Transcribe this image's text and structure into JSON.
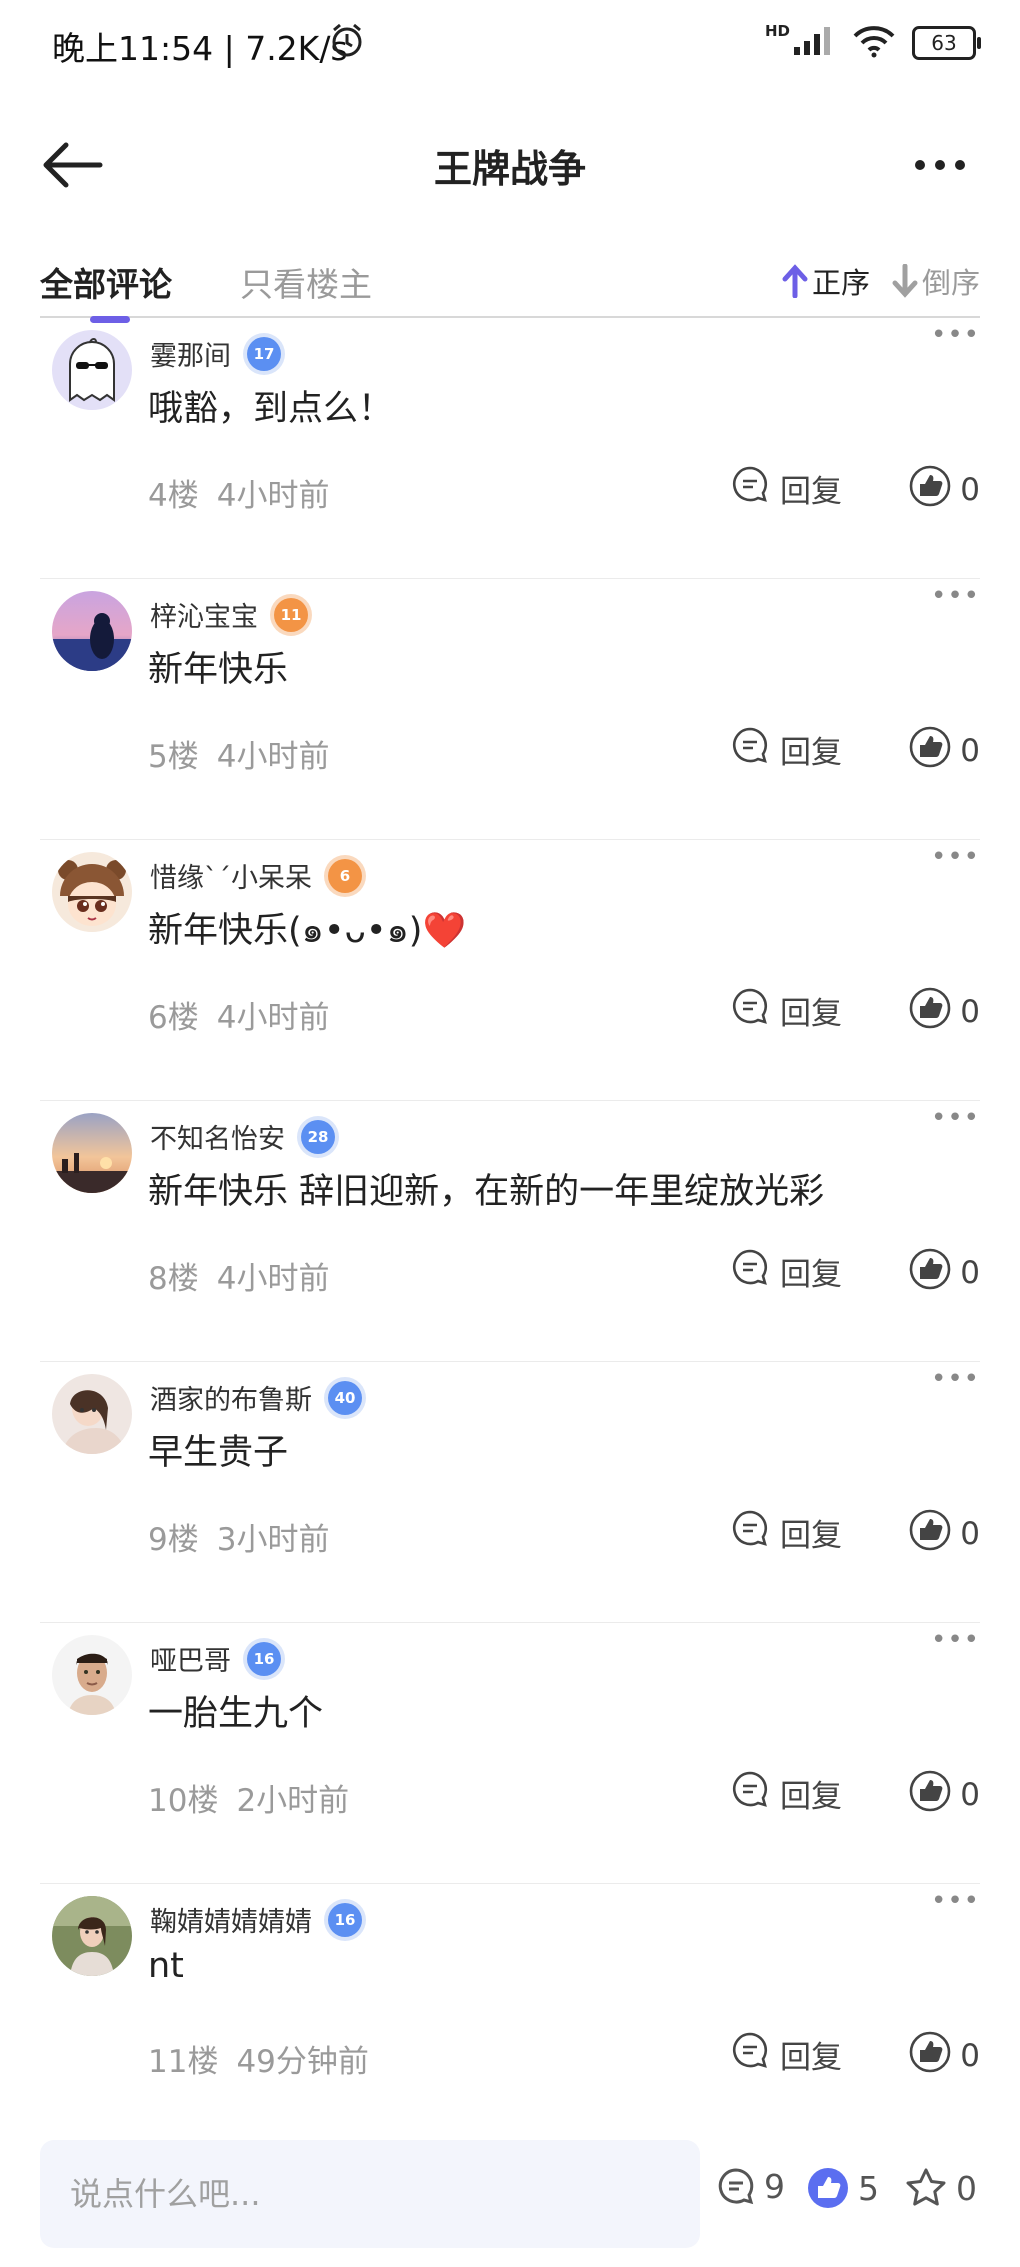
{
  "status_bar": {
    "time": "晚上11:54 | 7.2K/s",
    "network": "HD",
    "battery": "63"
  },
  "nav": {
    "title": "王牌战争",
    "back_icon": "arrow-left-icon",
    "more_icon": "more-dots-icon"
  },
  "tabs": {
    "all": "全部评论",
    "op_only": "只看楼主",
    "sort_asc": "正序",
    "sort_desc": "倒序"
  },
  "reply_label": "回复",
  "comments": [
    {
      "user": "霎那间",
      "level": "17",
      "level_color": "blue",
      "text": "哦豁，到点么！",
      "floor": "4楼",
      "time": "4小时前",
      "likes": "0",
      "avatar": "ghost-sunglasses"
    },
    {
      "user": "梓沁宝宝",
      "level": "11",
      "level_color": "orange",
      "text": "新年快乐",
      "floor": "5楼",
      "time": "4小时前",
      "likes": "0",
      "avatar": "sea-girl"
    },
    {
      "user": "惜缘ˋˊ小呆呆",
      "level": "6",
      "level_color": "orange",
      "text": "新年快乐(๑•ᴗ•๑)",
      "text_suffix": "❤️",
      "floor": "6楼",
      "time": "4小时前",
      "likes": "0",
      "avatar": "anime-bear-hat"
    },
    {
      "user": "不知名怡安",
      "level": "28",
      "level_color": "blue",
      "text": "新年快乐 辞旧迎新，在新的一年里绽放光彩",
      "floor": "8楼",
      "time": "4小时前",
      "likes": "0",
      "avatar": "sunset"
    },
    {
      "user": "酒家的布鲁斯",
      "level": "40",
      "level_color": "blue",
      "text": "早生贵子",
      "floor": "9楼",
      "time": "3小时前",
      "likes": "0",
      "avatar": "girl-photo"
    },
    {
      "user": "哑巴哥",
      "level": "16",
      "level_color": "blue",
      "text": "一胎生九个",
      "floor": "10楼",
      "time": "2小时前",
      "likes": "0",
      "avatar": "man-portrait"
    },
    {
      "user": "鞠婧婧婧婧婧",
      "level": "16",
      "level_color": "blue",
      "text": "nt",
      "floor": "11楼",
      "time": "49分钟前",
      "likes": "0",
      "avatar": "woman-outdoor"
    }
  ],
  "bottom_bar": {
    "placeholder": "说点什么吧...",
    "comment_count": "9",
    "like_count": "5",
    "star_count": "0"
  },
  "colors": {
    "accent": "#6d5fe6",
    "level_blue": "#5b8ff2",
    "level_orange": "#f39445"
  }
}
